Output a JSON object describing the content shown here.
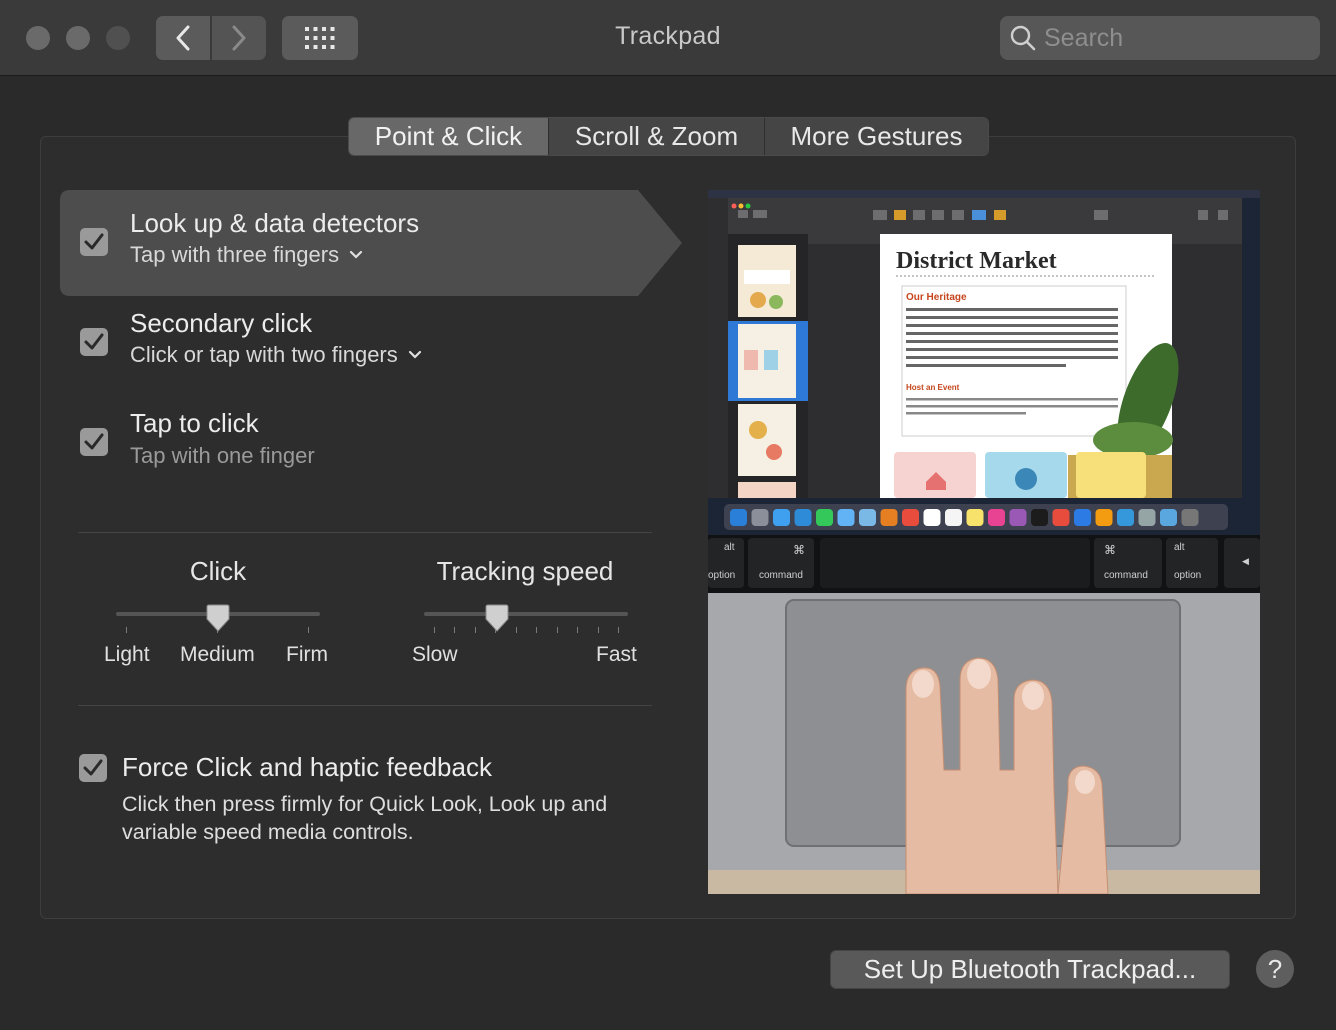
{
  "window": {
    "title": "Trackpad",
    "search_placeholder": "Search"
  },
  "tabs": [
    {
      "label": "Point & Click",
      "active": true
    },
    {
      "label": "Scroll & Zoom",
      "active": false
    },
    {
      "label": "More Gestures",
      "active": false
    }
  ],
  "options": [
    {
      "title": "Look up & data detectors",
      "subtitle": "Tap with three fingers",
      "checked": true,
      "has_dropdown": true
    },
    {
      "title": "Secondary click",
      "subtitle": "Click or tap with two fingers",
      "checked": true,
      "has_dropdown": true
    },
    {
      "title": "Tap to click",
      "subtitle": "Tap with one finger",
      "checked": true,
      "has_dropdown": false
    }
  ],
  "click_slider": {
    "label": "Click",
    "ticks": [
      "Light",
      "Medium",
      "Firm"
    ],
    "value": "Medium"
  },
  "tracking_slider": {
    "label": "Tracking speed",
    "min_label": "Slow",
    "max_label": "Fast",
    "value_fraction": 0.35
  },
  "force_click": {
    "title": "Force Click and haptic feedback",
    "description": "Click then press firmly for Quick Look, Look up and variable speed media controls.",
    "checked": true
  },
  "preview": {
    "doc_title": "District Market",
    "doc_heading": "Our Heritage",
    "doc_subheading": "Host an Event",
    "keys": [
      "alt",
      "option",
      "command",
      "command",
      "alt",
      "option"
    ]
  },
  "footer": {
    "bluetooth_button": "Set Up Bluetooth Trackpad...",
    "help": "?"
  },
  "colors": {
    "window_bg": "#2a2a2a",
    "titlebar_bg": "#3a3a3a",
    "highlight_bg": "#4d4d4d",
    "tab_active": "#686868"
  }
}
